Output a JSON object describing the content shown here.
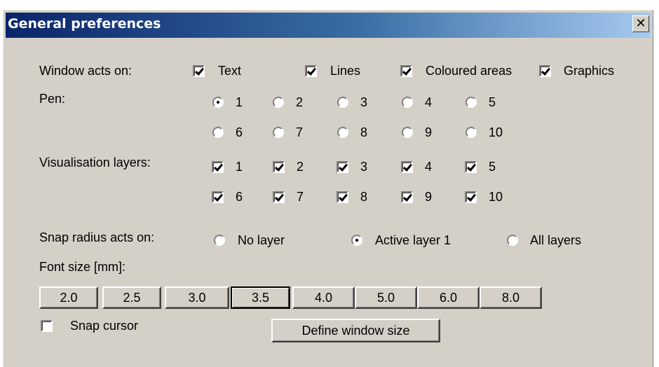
{
  "window": {
    "title": "General preferences",
    "close_glyph": "✕"
  },
  "window_acts_on": {
    "label": "Window acts on:",
    "options": [
      {
        "label": "Text",
        "checked": true
      },
      {
        "label": "Lines",
        "checked": true
      },
      {
        "label": "Coloured areas",
        "checked": true
      },
      {
        "label": "Graphics",
        "checked": true
      }
    ]
  },
  "pen": {
    "label": "Pen:",
    "options": [
      "1",
      "2",
      "3",
      "4",
      "5",
      "6",
      "7",
      "8",
      "9",
      "10"
    ],
    "selected": "1"
  },
  "visualisation_layers": {
    "label": "Visualisation layers:",
    "options": [
      "1",
      "2",
      "3",
      "4",
      "5",
      "6",
      "7",
      "8",
      "9",
      "10"
    ],
    "checked": [
      true,
      true,
      true,
      true,
      true,
      true,
      true,
      true,
      true,
      true
    ]
  },
  "snap_radius": {
    "label": "Snap radius acts on:",
    "options": [
      "No layer",
      "Active layer 1",
      "All layers"
    ],
    "selected": "Active layer 1"
  },
  "font_size": {
    "label": "Font size [mm]:",
    "buttons": [
      "2.0",
      "2.5",
      "3.0",
      "3.5",
      "4.0",
      "5.0",
      "6.0",
      "8.0"
    ],
    "selected": "3.5"
  },
  "snap_cursor": {
    "label": "Snap cursor",
    "checked": false
  },
  "define_window_size": {
    "label": "Define window size"
  }
}
